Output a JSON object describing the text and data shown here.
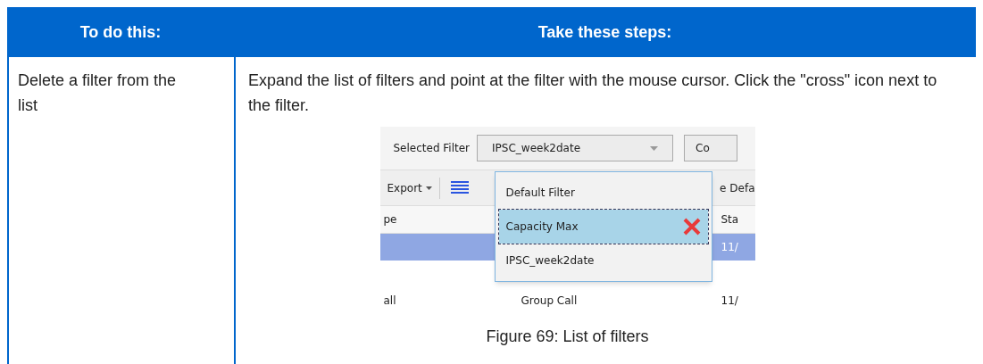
{
  "table": {
    "columns": [
      "To do this:",
      "Take these steps:"
    ],
    "rows": [
      {
        "task": "Delete a filter from the list",
        "steps": "Expand the list of filters and point at the filter with the mouse cursor. Click the \"cross\" icon next to the filter.",
        "figure": {
          "caption": "Figure 69: List of filters",
          "screenshot": {
            "filter_label": "Selected Filter",
            "filter_value": "IPSC_week2date",
            "side_button": "Co",
            "export_button": "Export",
            "toolbar_text": "e Defa",
            "grid_header": [
              "pe",
              "Sta"
            ],
            "grid_rows": [
              {
                "selected": true,
                "cells": [
                  "",
                  "",
                  "11/"
                ]
              },
              {
                "selected": false,
                "cells": [
                  "all",
                  "Group Call",
                  "11/"
                ]
              }
            ],
            "dropdown_items": [
              {
                "label": "Default Filter",
                "selected": false
              },
              {
                "label": "Capacity Max",
                "selected": true
              },
              {
                "label": "IPSC_week2date",
                "selected": false
              }
            ]
          }
        }
      }
    ]
  }
}
